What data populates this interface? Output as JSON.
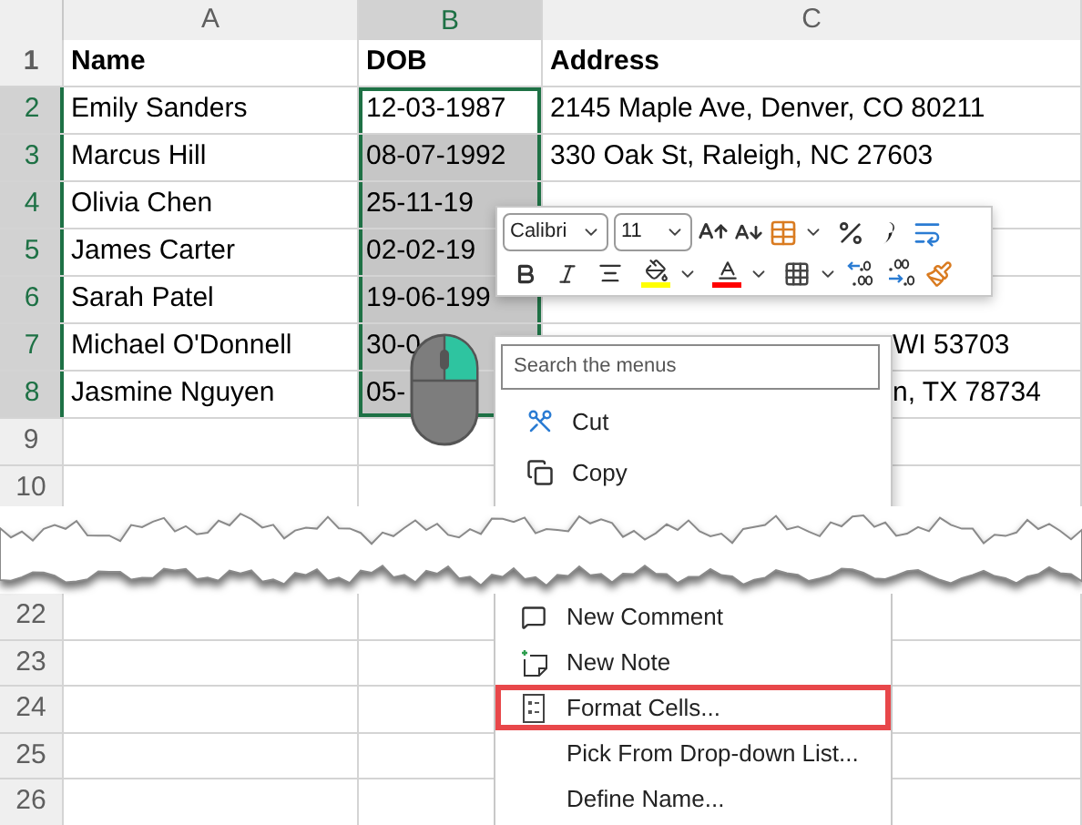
{
  "columns": [
    {
      "label": "A",
      "selected": false
    },
    {
      "label": "B",
      "selected": true
    },
    {
      "label": "C",
      "selected": false
    }
  ],
  "rows": [
    {
      "number": "1",
      "selected": false,
      "kind": "heading",
      "cells": [
        {
          "text": "Name",
          "kind": "text",
          "selected": false,
          "active": false
        },
        {
          "text": "DOB",
          "kind": "text",
          "selected": false,
          "active": false
        },
        {
          "text": "Address",
          "kind": "text",
          "selected": false,
          "active": false
        }
      ]
    },
    {
      "number": "2",
      "selected": true,
      "kind": "data",
      "cells": [
        {
          "text": "Emily Sanders",
          "kind": "text",
          "selected": false,
          "active": false
        },
        {
          "text": "12-03-1987",
          "kind": "text",
          "selected": true,
          "active": true
        },
        {
          "text": "2145 Maple Ave, Denver, CO 80211",
          "kind": "text",
          "selected": false,
          "active": false
        }
      ]
    },
    {
      "number": "3",
      "selected": true,
      "kind": "data",
      "cells": [
        {
          "text": "Marcus Hill",
          "kind": "text",
          "selected": false,
          "active": false
        },
        {
          "text": "08-07-1992",
          "kind": "text",
          "selected": true,
          "active": false
        },
        {
          "text": "330 Oak St, Raleigh, NC 27603",
          "kind": "text",
          "selected": false,
          "active": false
        }
      ]
    },
    {
      "number": "4",
      "selected": true,
      "kind": "data",
      "cells": [
        {
          "text": "Olivia Chen",
          "kind": "text",
          "selected": false,
          "active": false
        },
        {
          "text": "25-11-19",
          "kind": "text",
          "selected": true,
          "active": false
        }
      ]
    },
    {
      "number": "5",
      "selected": true,
      "kind": "data",
      "cells": [
        {
          "text": "James Carter",
          "kind": "text",
          "selected": false,
          "active": false
        },
        {
          "text": "02-02-19",
          "kind": "text",
          "selected": true,
          "active": false
        }
      ]
    },
    {
      "number": "6",
      "selected": true,
      "kind": "data",
      "cells": [
        {
          "text": "Sarah Patel",
          "kind": "text",
          "selected": false,
          "active": false
        },
        {
          "text": "19-06-199",
          "kind": "text",
          "selected": true,
          "active": false
        }
      ]
    },
    {
      "number": "7",
      "selected": true,
      "kind": "data",
      "cells": [
        {
          "text": "Michael O'Donnell",
          "kind": "text",
          "selected": false,
          "active": false
        },
        {
          "text": "30-0",
          "kind": "text",
          "selected": true,
          "active": false
        },
        {
          "text": "WI 53703",
          "kind": "clipped",
          "selected": false,
          "active": false
        }
      ]
    },
    {
      "number": "8",
      "selected": true,
      "kind": "data",
      "cells": [
        {
          "text": "Jasmine Nguyen",
          "kind": "text",
          "selected": false,
          "active": false
        },
        {
          "text": "05-",
          "kind": "text",
          "selected": true,
          "active": false
        },
        {
          "text": "n, TX 78734",
          "kind": "clipped",
          "selected": false,
          "active": false
        }
      ]
    },
    {
      "number": "9",
      "selected": false
    },
    {
      "number": "10",
      "selected": false
    }
  ],
  "lower_rows": [
    {
      "number": "22",
      "selected": false
    },
    {
      "number": "23",
      "selected": false
    },
    {
      "number": "24",
      "selected": false
    },
    {
      "number": "25",
      "selected": false
    },
    {
      "number": "26",
      "selected": false
    }
  ],
  "mini_toolbar": {
    "font": "Calibri",
    "size": "11"
  },
  "context_menu": {
    "search_placeholder": "Search the menus",
    "upper_items": [
      {
        "label": "Cut",
        "kind": "cut",
        "selected": false
      },
      {
        "label": "Copy",
        "kind": "copy",
        "selected": false
      }
    ],
    "lower_items": [
      {
        "label": "New Comment",
        "kind": "comment",
        "selected": false
      },
      {
        "label": "New Note",
        "kind": "note",
        "selected": false
      },
      {
        "label": "Format Cells...",
        "kind": "format",
        "selected": true
      },
      {
        "label": "Pick From Drop-down List...",
        "kind": "plain",
        "selected": false
      },
      {
        "label": "Define Name...",
        "kind": "plain",
        "selected": false
      }
    ]
  }
}
